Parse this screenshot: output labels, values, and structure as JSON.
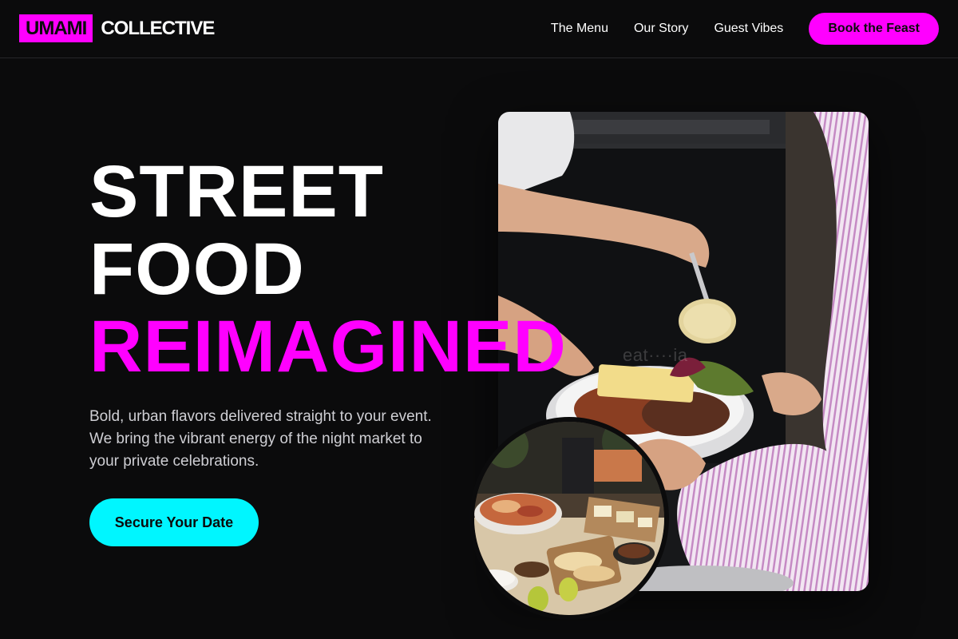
{
  "brand": {
    "logo_box": "UMAMI",
    "logo_rest": "COLLECTIVE",
    "accent_color": "#ff00ff",
    "secondary_accent": "#00f6ff",
    "background": "#0b0b0c"
  },
  "nav": {
    "links": [
      "The Menu",
      "Our Story",
      "Guest Vibes"
    ],
    "cta_label": "Book the Feast"
  },
  "hero": {
    "title_line1": "STREET",
    "title_line2": "FOOD",
    "title_line3": "REIMAGINED",
    "subtitle": "Bold, urban flavors delivered straight to your event. We bring the vibrant energy of the night market to your private celebrations.",
    "cta_label": "Secure Your Date"
  },
  "images": {
    "main": "food-photo-server-plating",
    "secondary": "food-photo-buffet-spread"
  }
}
